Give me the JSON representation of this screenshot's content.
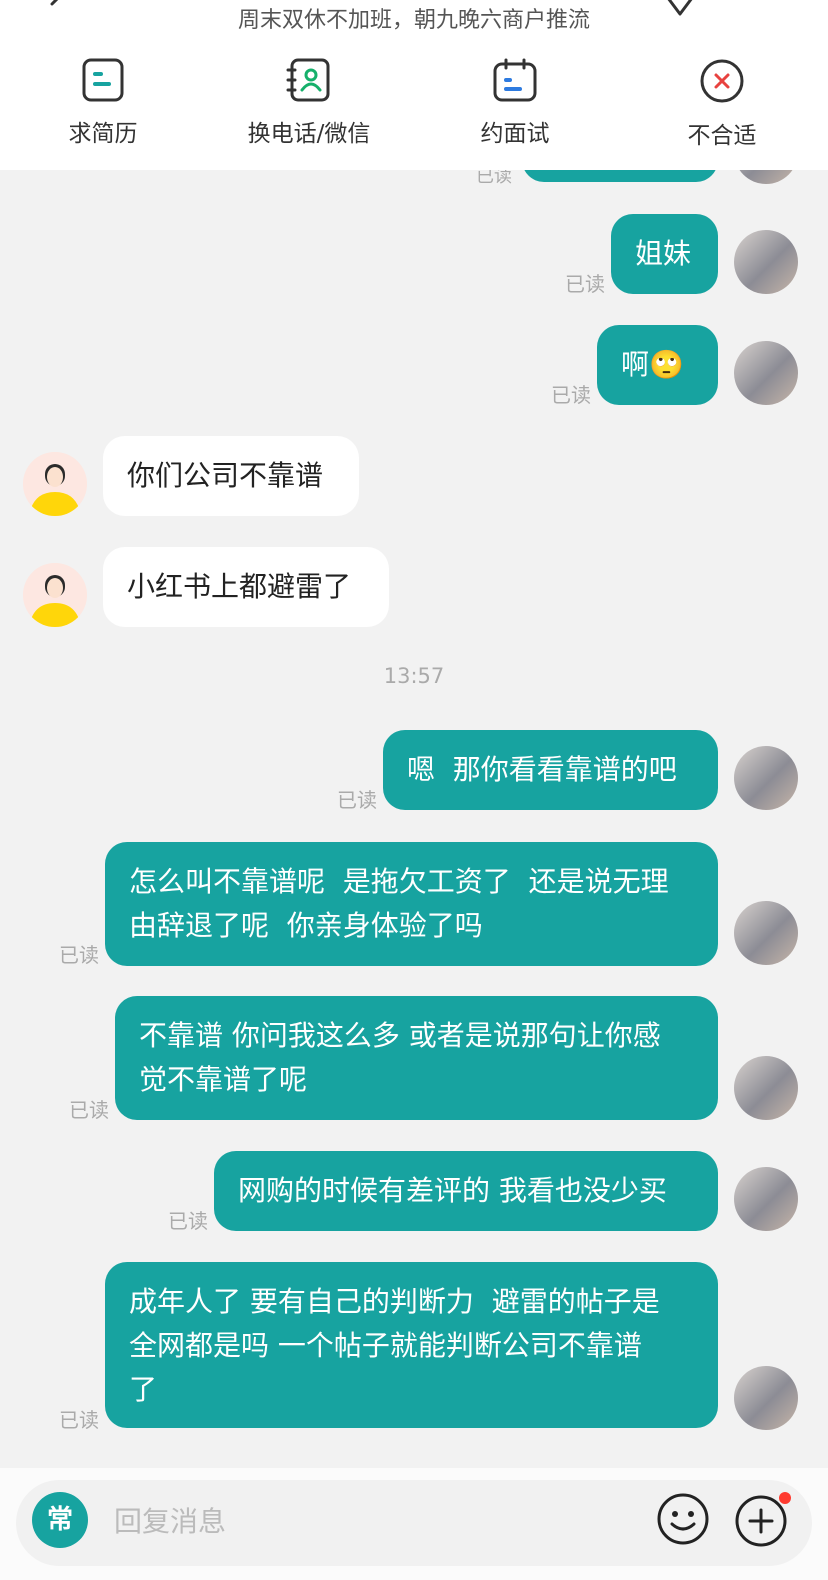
{
  "header": {
    "subtitle": "周末双休不加班，朝九晚六商户推流",
    "actions": [
      {
        "label": "求简历"
      },
      {
        "label": "换电话/微信"
      },
      {
        "label": "约面试"
      },
      {
        "label": "不合适"
      }
    ]
  },
  "read_label": "已读",
  "timestamp": "13:57",
  "messages": [
    {
      "text": "姐妹"
    },
    {
      "text": "啊🙄"
    },
    {
      "text": "你们公司不靠谱"
    },
    {
      "text": "小红书上都避雷了"
    },
    {
      "text": "嗯  那你看看靠谱的吧"
    },
    {
      "line1": "怎么叫不靠谱呢  是拖欠工资了  还是说无理",
      "line2": "由辞退了呢  你亲身体验了吗"
    },
    {
      "line1": "不靠谱 你问我这么多 或者是说那句让你感",
      "line2": "觉不靠谱了呢"
    },
    {
      "text": "网购的时候有差评的 我看也没少买"
    },
    {
      "line1": "成年人了 要有自己的判断力  避雷的帖子是",
      "line2": "全网都是吗 一个帖子就能判断公司不靠谱",
      "line3": "了"
    }
  ],
  "input": {
    "common_label": "常",
    "placeholder": "回复消息"
  },
  "colors": {
    "accent": "#17a3a0",
    "background": "#f2f2f2",
    "notification": "#ff3b30"
  }
}
